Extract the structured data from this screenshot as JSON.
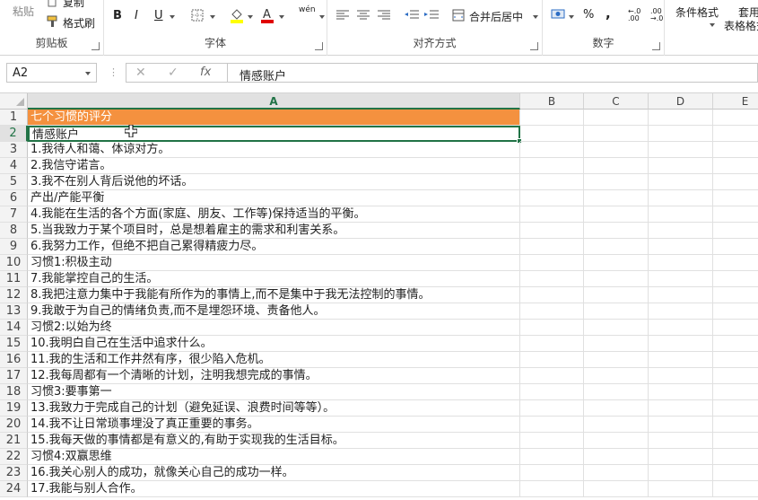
{
  "ribbon": {
    "clipboard": {
      "paste_label": "粘贴",
      "copy_label": "复制",
      "format_painter_label": "格式刷",
      "group_label": "剪贴板"
    },
    "font": {
      "bold": "B",
      "italic": "I",
      "underline": "U",
      "wen": "wén",
      "group_label": "字体"
    },
    "alignment": {
      "merge_label": "合并后居中",
      "group_label": "对齐方式"
    },
    "number": {
      "percent": "%",
      "comma": ",",
      "group_label": "数字",
      "inc_decimal": "←.0 .00",
      "dec_decimal": ".00 →.0"
    },
    "styles": {
      "conditional_label": "条件格式",
      "table_label_1": "套用",
      "table_label_2": "表格格式"
    }
  },
  "formula_bar": {
    "name_box": "A2",
    "cancel": "✕",
    "enter": "✓",
    "fx": "fx",
    "content": "情感账户"
  },
  "columns": [
    "A",
    "B",
    "C",
    "D",
    "E"
  ],
  "rows": [
    {
      "n": "1",
      "a": "七个习惯的评分"
    },
    {
      "n": "2",
      "a": "情感账户"
    },
    {
      "n": "3",
      "a": "1.我待人和蔼、体谅对方。"
    },
    {
      "n": "4",
      "a": "2.我信守诺言。"
    },
    {
      "n": "5",
      "a": "3.我不在别人背后说他的坏话。"
    },
    {
      "n": "6",
      "a": "产出/产能平衡"
    },
    {
      "n": "7",
      "a": "4.我能在生活的各个方面(家庭、朋友、工作等)保持适当的平衡。"
    },
    {
      "n": "8",
      "a": "5.当我致力于某个项目时，总是想着雇主的需求和利害关系。"
    },
    {
      "n": "9",
      "a": "6.我努力工作，但绝不把自己累得精疲力尽。"
    },
    {
      "n": "10",
      "a": "习惯1:积极主动"
    },
    {
      "n": "11",
      "a": "7.我能掌控自己的生活。"
    },
    {
      "n": "12",
      "a": "8.我把注意力集中于我能有所作为的事情上,而不是集中于我无法控制的事情。"
    },
    {
      "n": "13",
      "a": "9.我敢于为自己的情绪负责,而不是埋怨环境、责备他人。"
    },
    {
      "n": "14",
      "a": "习惯2:以始为终"
    },
    {
      "n": "15",
      "a": "10.我明白自己在生活中追求什么。"
    },
    {
      "n": "16",
      "a": "11.我的生活和工作井然有序，很少陷入危机。"
    },
    {
      "n": "17",
      "a": "12.我每周都有一个清晰的计划，注明我想完成的事情。"
    },
    {
      "n": "18",
      "a": "习惯3:要事第一"
    },
    {
      "n": "19",
      "a": "13.我致力于完成自己的计划（避免延误、浪费时间等等）。"
    },
    {
      "n": "20",
      "a": "14.我不让日常琐事埋没了真正重要的事务。"
    },
    {
      "n": "21",
      "a": "15.我每天做的事情都是有意义的,有助于实现我的生活目标。"
    },
    {
      "n": "22",
      "a": "习惯4:双赢思维"
    },
    {
      "n": "23",
      "a": "16.我关心别人的成功，就像关心自己的成功一样。"
    },
    {
      "n": "24",
      "a": "17.我能与别人合作。"
    }
  ],
  "colors": {
    "title_fill": "#f4913f",
    "accent": "#217346"
  }
}
